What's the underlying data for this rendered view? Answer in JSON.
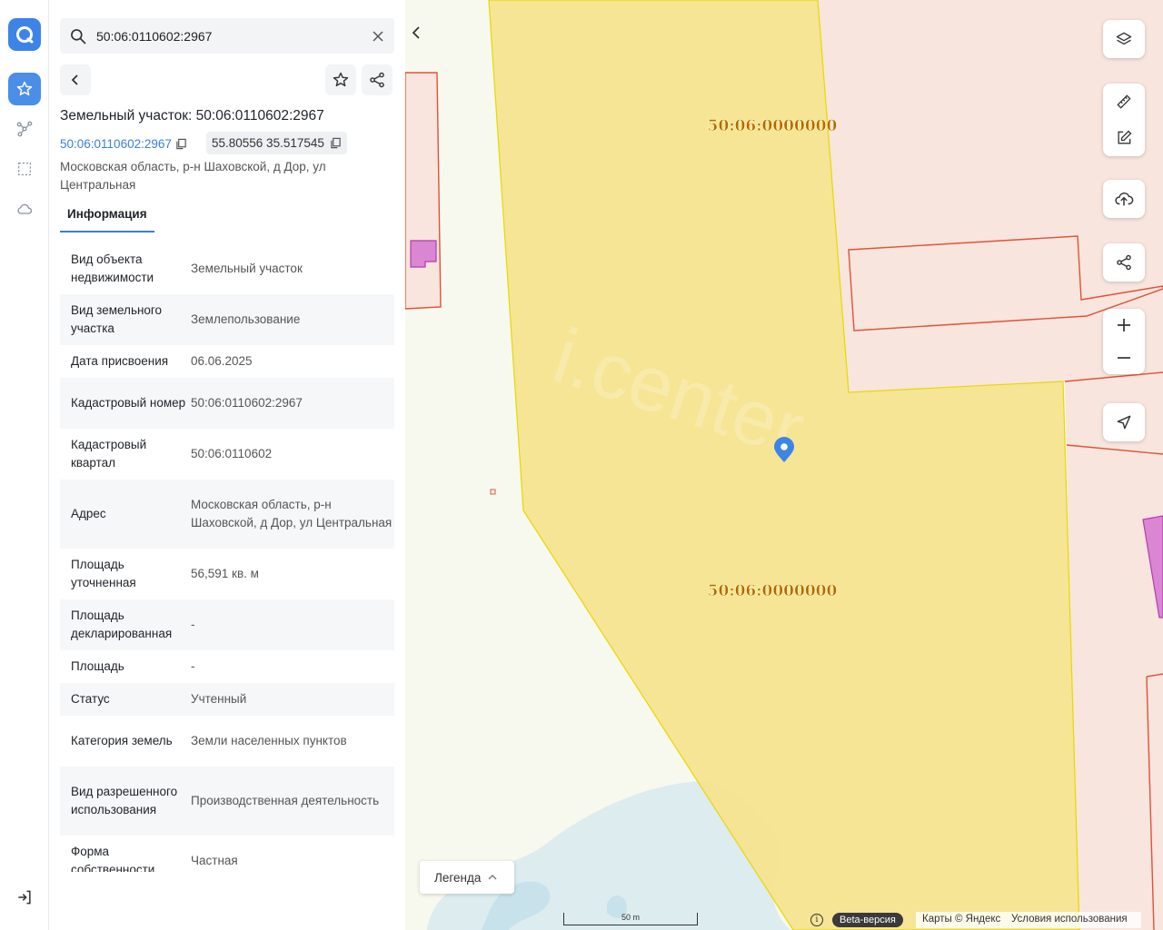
{
  "search": {
    "value": "50:06:0110602:2967"
  },
  "header": {
    "title": "Земельный участок: 50:06:0110602:2967",
    "cadastral_link": "50:06:0110602:2967",
    "coordinates": "55.80556 35.517545",
    "address": "Московская область, р-н Шаховской, д Дор, ул Центральная"
  },
  "tabs": [
    {
      "label": "Информация"
    }
  ],
  "info_rows": [
    {
      "key": "Вид объекта недвижимости",
      "value": "Земельный участок"
    },
    {
      "key": "Вид земельного участка",
      "value": "Землепользование"
    },
    {
      "key": "Дата присвоения",
      "value": "06.06.2025"
    },
    {
      "key": "Кадастровый номер",
      "value": "50:06:0110602:2967"
    },
    {
      "key": "Кадастровый квартал",
      "value": "50:06:0110602"
    },
    {
      "key": "Адрес",
      "value": "Московская область, р-н Шаховской, д Дор, ул Центральная"
    },
    {
      "key": "Площадь уточненная",
      "value": "56,591 кв. м"
    },
    {
      "key": "Площадь декларированная",
      "value": "-"
    },
    {
      "key": "Площадь",
      "value": "-"
    },
    {
      "key": "Статус",
      "value": "Учтенный"
    },
    {
      "key": "Категория земель",
      "value": "Земли населенных пунктов"
    },
    {
      "key": "Вид разрешенного использования",
      "value": "Производственная деятельность"
    },
    {
      "key": "Форма собственности",
      "value": "Частная"
    }
  ],
  "map": {
    "parcel_labels": [
      "50:06:0000000",
      "50:06:0000000"
    ],
    "watermark": "i.center",
    "legend_label": "Легенда",
    "scale_label": "50 m",
    "beta_label": "Beta-версия",
    "attribution": "Карты © Яндекс",
    "terms": "Условия использования",
    "info_glyph": "i"
  },
  "colors": {
    "accent": "#3d84e6",
    "link": "#3b7ddd",
    "parcel_fill": "#f6e48e",
    "parcel_stroke": "#e8d800",
    "boundary": "#e0523a",
    "building": "#d36ed0",
    "water": "#dcecef"
  },
  "icons": {
    "rail": [
      "app-logo-icon",
      "star-icon",
      "route-icon",
      "selection-icon",
      "cloud-icon",
      "logout-icon"
    ],
    "map_controls": [
      "layers-icon",
      "ruler-icon",
      "edit-icon",
      "upload-icon",
      "share-icon",
      "zoom-in-icon",
      "zoom-out-icon",
      "locate-icon"
    ]
  }
}
